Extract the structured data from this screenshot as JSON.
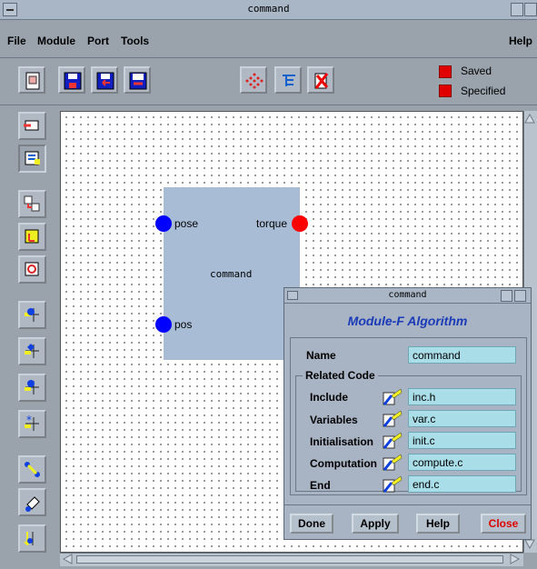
{
  "window": {
    "title": "command"
  },
  "menu": {
    "items": [
      "File",
      "Module",
      "Port",
      "Tools"
    ],
    "help": "Help"
  },
  "legend": {
    "saved": "Saved",
    "specified": "Specified",
    "color": "#e00000"
  },
  "module": {
    "name": "command",
    "ports": {
      "top_left": "pose",
      "top_right": "torque",
      "bottom_left": "pos"
    },
    "colors": {
      "input": "#0000ff",
      "output": "#ff0000"
    }
  },
  "dialog": {
    "title": "command",
    "heading": "Module-F Algorithm",
    "name_label": "Name",
    "name_value": "command",
    "group_label": "Related Code",
    "rows": [
      {
        "label": "Include",
        "value": "inc.h"
      },
      {
        "label": "Variables",
        "value": "var.c"
      },
      {
        "label": "Initialisation",
        "value": "init.c"
      },
      {
        "label": "Computation",
        "value": "compute.c"
      },
      {
        "label": "End",
        "value": "end.c"
      }
    ],
    "buttons": {
      "done": "Done",
      "apply": "Apply",
      "help": "Help",
      "close": "Close"
    }
  }
}
